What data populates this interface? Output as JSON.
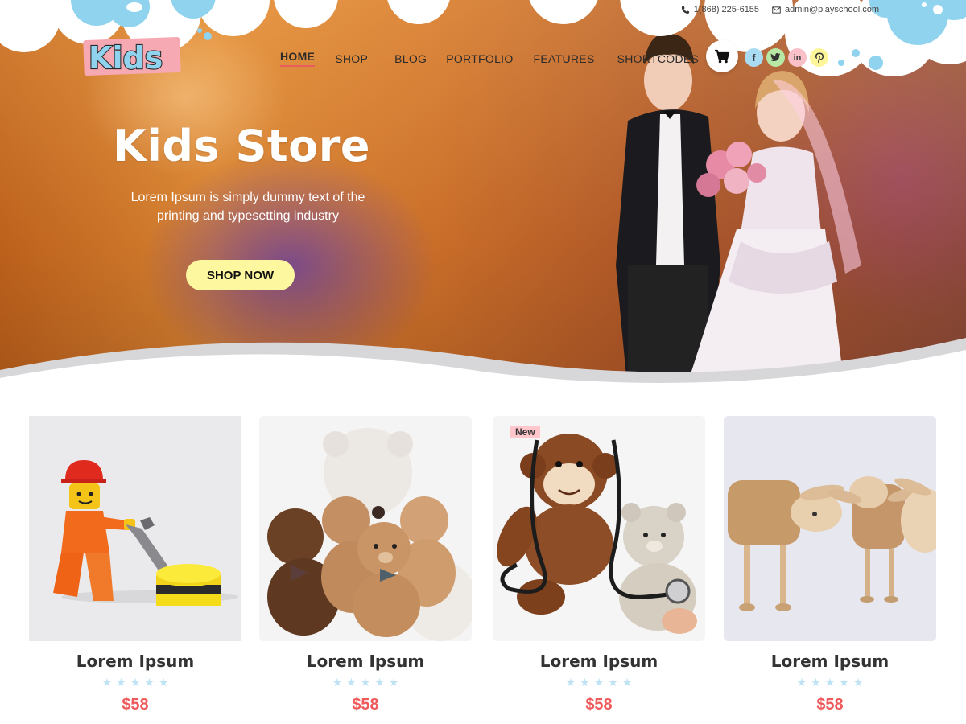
{
  "topbar": {
    "phone": "1(868) 225-6155",
    "email": "admin@playschool.com"
  },
  "logo": {
    "text": "Kids"
  },
  "nav": {
    "items": [
      {
        "label": "HOME",
        "active": true
      },
      {
        "label": "SHOP"
      },
      {
        "label": "BLOG"
      },
      {
        "label": "PORTFOLIO"
      },
      {
        "label": "FEATURES"
      },
      {
        "label": "SHORTCODES"
      }
    ]
  },
  "social": {
    "facebook": "f",
    "twitter": "twitter-icon",
    "linkedin": "in",
    "pinterest": "pinterest-icon"
  },
  "hero": {
    "title": "Kids Store",
    "subtitle": "Lorem Ipsum is simply dummy text of the printing and typesetting industry",
    "button": "SHOP NOW"
  },
  "products": [
    {
      "name": "Lorem Ipsum",
      "price": "$58",
      "rating": 0,
      "image": "lego-worker-image"
    },
    {
      "name": "Lorem Ipsum",
      "price": "$58",
      "rating": 0,
      "image": "teddy-bears-image"
    },
    {
      "name": "Lorem Ipsum",
      "price": "$58",
      "rating": 0,
      "image": "plush-monkey-image",
      "badge": "New"
    },
    {
      "name": "Lorem Ipsum",
      "price": "$58",
      "rating": 0,
      "image": "wooden-sheep-image"
    }
  ],
  "colors": {
    "accent": "#ef5a5a",
    "button": "#fdf7a0",
    "star": "#bfe3f5",
    "cloud": "#8fd3ef"
  }
}
